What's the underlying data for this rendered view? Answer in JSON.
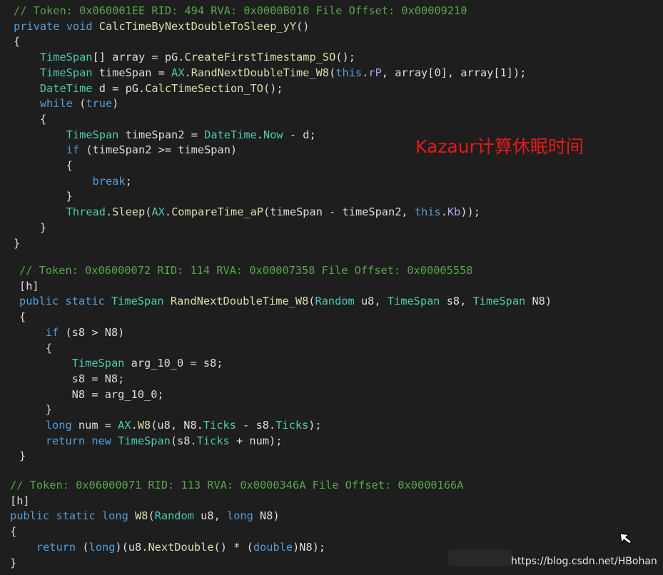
{
  "colors": {
    "background": "#1e1e1e",
    "plain": "#dcdcdc",
    "keyword": "#569cd6",
    "type": "#4ec9b0",
    "method": "#dcdcaa",
    "comment": "#57a64a",
    "field": "#b8a2f2",
    "annotation": "#e41a1a"
  },
  "blocks": [
    {
      "lines": [
        [
          [
            "// Token: 0x060001EE RID: 494 RVA: 0x0000B010 File Offset: 0x00009210",
            "c"
          ]
        ],
        [
          [
            "private",
            "k"
          ],
          [
            " ",
            "p"
          ],
          [
            "void",
            "k"
          ],
          [
            " ",
            "p"
          ],
          [
            "CalcTimeByNextDoubleToSleep_yY",
            "m"
          ],
          [
            "()",
            "p"
          ]
        ],
        [
          [
            "{",
            "p"
          ]
        ],
        [
          [
            "    ",
            "p"
          ],
          [
            "TimeSpan",
            "t"
          ],
          [
            "[] array = pG.",
            "p"
          ],
          [
            "CreateFirstTimestamp_SO",
            "m"
          ],
          [
            "();",
            "p"
          ]
        ],
        [
          [
            "    ",
            "p"
          ],
          [
            "TimeSpan",
            "t"
          ],
          [
            " timeSpan = ",
            "p"
          ],
          [
            "AX",
            "t"
          ],
          [
            ".",
            "p"
          ],
          [
            "RandNextDoubleTime_W8",
            "m"
          ],
          [
            "(",
            "p"
          ],
          [
            "this",
            "k"
          ],
          [
            ".",
            "p"
          ],
          [
            "rP",
            "f"
          ],
          [
            ", array[0], array[1]);",
            "p"
          ]
        ],
        [
          [
            "    ",
            "p"
          ],
          [
            "DateTime",
            "t"
          ],
          [
            " d = pG.",
            "p"
          ],
          [
            "CalcTimeSection_TO",
            "m"
          ],
          [
            "();",
            "p"
          ]
        ],
        [
          [
            "    ",
            "p"
          ],
          [
            "while",
            "k"
          ],
          [
            " (",
            "p"
          ],
          [
            "true",
            "k"
          ],
          [
            ")",
            "p"
          ]
        ],
        [
          [
            "    {",
            "p"
          ]
        ],
        [
          [
            "        ",
            "p"
          ],
          [
            "TimeSpan",
            "t"
          ],
          [
            " timeSpan2 = ",
            "p"
          ],
          [
            "DateTime",
            "t"
          ],
          [
            ".",
            "p"
          ],
          [
            "Now",
            "n"
          ],
          [
            " - d;",
            "p"
          ]
        ],
        [
          [
            "        ",
            "p"
          ],
          [
            "if",
            "k"
          ],
          [
            " (timeSpan2 >= timeSpan)",
            "p"
          ]
        ],
        [
          [
            "        {",
            "p"
          ]
        ],
        [
          [
            "            ",
            "p"
          ],
          [
            "break",
            "k"
          ],
          [
            ";",
            "p"
          ]
        ],
        [
          [
            "        }",
            "p"
          ]
        ],
        [
          [
            "        ",
            "p"
          ],
          [
            "Thread",
            "t"
          ],
          [
            ".",
            "p"
          ],
          [
            "Sleep",
            "m"
          ],
          [
            "(",
            "p"
          ],
          [
            "AX",
            "t"
          ],
          [
            ".",
            "p"
          ],
          [
            "CompareTime_aP",
            "m"
          ],
          [
            "(timeSpan - timeSpan2, ",
            "p"
          ],
          [
            "this",
            "k"
          ],
          [
            ".",
            "p"
          ],
          [
            "Kb",
            "f"
          ],
          [
            "));",
            "p"
          ]
        ],
        [
          [
            "    }",
            "p"
          ]
        ],
        [
          [
            "}",
            "p"
          ]
        ]
      ]
    },
    {
      "lines": [
        [
          [
            "// Token: 0x06000072 RID: 114 RVA: 0x00007358 File Offset: 0x00005558",
            "c"
          ]
        ],
        [
          [
            "[h]",
            "p"
          ]
        ],
        [
          [
            "public",
            "k"
          ],
          [
            " ",
            "p"
          ],
          [
            "static",
            "k"
          ],
          [
            " ",
            "p"
          ],
          [
            "TimeSpan",
            "t"
          ],
          [
            " ",
            "p"
          ],
          [
            "RandNextDoubleTime_W8",
            "m"
          ],
          [
            "(",
            "p"
          ],
          [
            "Random",
            "t"
          ],
          [
            " u8, ",
            "p"
          ],
          [
            "TimeSpan",
            "t"
          ],
          [
            " s8, ",
            "p"
          ],
          [
            "TimeSpan",
            "t"
          ],
          [
            " N8)",
            "p"
          ]
        ],
        [
          [
            "{",
            "p"
          ]
        ],
        [
          [
            "    ",
            "p"
          ],
          [
            "if",
            "k"
          ],
          [
            " (s8 > N8)",
            "p"
          ]
        ],
        [
          [
            "    {",
            "p"
          ]
        ],
        [
          [
            "        ",
            "p"
          ],
          [
            "TimeSpan",
            "t"
          ],
          [
            " arg_10_0 = s8;",
            "p"
          ]
        ],
        [
          [
            "        s8 = N8;",
            "p"
          ]
        ],
        [
          [
            "        N8 = arg_10_0;",
            "p"
          ]
        ],
        [
          [
            "    }",
            "p"
          ]
        ],
        [
          [
            "    ",
            "p"
          ],
          [
            "long",
            "k"
          ],
          [
            " num = ",
            "p"
          ],
          [
            "AX",
            "t"
          ],
          [
            ".",
            "p"
          ],
          [
            "W8",
            "m"
          ],
          [
            "(u8, N8.",
            "p"
          ],
          [
            "Ticks",
            "n"
          ],
          [
            " - s8.",
            "p"
          ],
          [
            "Ticks",
            "n"
          ],
          [
            ");",
            "p"
          ]
        ],
        [
          [
            "    ",
            "p"
          ],
          [
            "return",
            "k"
          ],
          [
            " ",
            "p"
          ],
          [
            "new",
            "k"
          ],
          [
            " ",
            "p"
          ],
          [
            "TimeSpan",
            "t"
          ],
          [
            "(s8.",
            "p"
          ],
          [
            "Ticks",
            "n"
          ],
          [
            " + num);",
            "p"
          ]
        ],
        [
          [
            "}",
            "p"
          ]
        ]
      ]
    },
    {
      "lines": [
        [
          [
            "// Token: 0x06000071 RID: 113 RVA: 0x0000346A File Offset: 0x0000166A",
            "c"
          ]
        ],
        [
          [
            "[h]",
            "p"
          ]
        ],
        [
          [
            "public",
            "k"
          ],
          [
            " ",
            "p"
          ],
          [
            "static",
            "k"
          ],
          [
            " ",
            "p"
          ],
          [
            "long",
            "k"
          ],
          [
            " ",
            "p"
          ],
          [
            "W8",
            "m"
          ],
          [
            "(",
            "p"
          ],
          [
            "Random",
            "t"
          ],
          [
            " u8, ",
            "p"
          ],
          [
            "long",
            "k"
          ],
          [
            " N8)",
            "p"
          ]
        ],
        [
          [
            "{",
            "p"
          ]
        ],
        [
          [
            "    ",
            "p"
          ],
          [
            "return",
            "k"
          ],
          [
            " (",
            "p"
          ],
          [
            "long",
            "k"
          ],
          [
            ")(u8.",
            "p"
          ],
          [
            "NextDouble",
            "m"
          ],
          [
            "() * (",
            "p"
          ],
          [
            "double",
            "k"
          ],
          [
            ")N8);",
            "p"
          ]
        ],
        [
          [
            "}",
            "p"
          ]
        ]
      ]
    }
  ],
  "annotation": "Kazaur计算休眠时间",
  "watermark": "https://blog.csdn.net/HBohan",
  "cursor_icon": "arrow-cursor-icon"
}
